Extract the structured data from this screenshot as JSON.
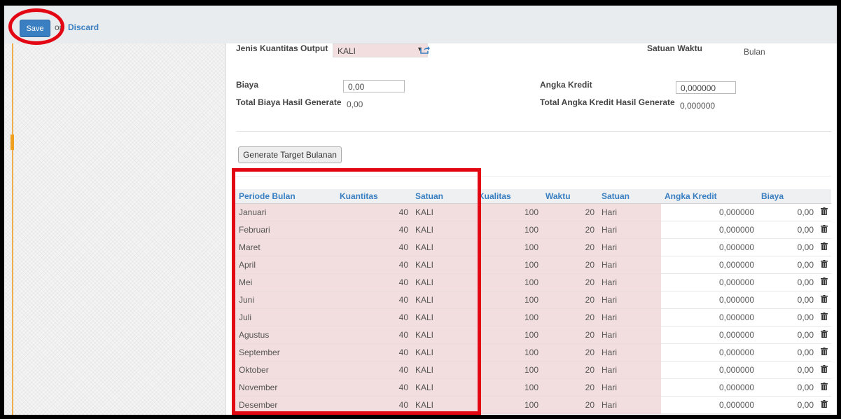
{
  "toolbar": {
    "save_label": "Save",
    "or_text": "or",
    "discard_label": "Discard"
  },
  "form": {
    "jenis_kuantitas_label": "Jenis Kuantitas Output",
    "jenis_kuantitas_value": "KALI",
    "satuan_waktu_label": "Satuan Waktu",
    "satuan_waktu_value": "Bulan",
    "biaya_label": "Biaya",
    "biaya_value": "0,00",
    "angka_kredit_label": "Angka Kredit",
    "angka_kredit_value": "0,000000",
    "total_biaya_label": "Total Biaya Hasil Generate",
    "total_biaya_value": "0,00",
    "total_angka_label": "Total Angka Kredit Hasil Generate",
    "total_angka_value": "0,000000",
    "generate_button_label": "Generate Target Bulanan"
  },
  "table": {
    "headers": [
      "Periode Bulan",
      "Kuantitas",
      "Satuan",
      "Kualitas",
      "Waktu",
      "Satuan",
      "Angka Kredit",
      "Biaya"
    ],
    "rows": [
      [
        "Januari",
        "40",
        "KALI",
        "100",
        "20",
        "Hari",
        "0,000000",
        "0,00"
      ],
      [
        "Februari",
        "40",
        "KALI",
        "100",
        "20",
        "Hari",
        "0,000000",
        "0,00"
      ],
      [
        "Maret",
        "40",
        "KALI",
        "100",
        "20",
        "Hari",
        "0,000000",
        "0,00"
      ],
      [
        "April",
        "40",
        "KALI",
        "100",
        "20",
        "Hari",
        "0,000000",
        "0,00"
      ],
      [
        "Mei",
        "40",
        "KALI",
        "100",
        "20",
        "Hari",
        "0,000000",
        "0,00"
      ],
      [
        "Juni",
        "40",
        "KALI",
        "100",
        "20",
        "Hari",
        "0,000000",
        "0,00"
      ],
      [
        "Juli",
        "40",
        "KALI",
        "100",
        "20",
        "Hari",
        "0,000000",
        "0,00"
      ],
      [
        "Agustus",
        "40",
        "KALI",
        "100",
        "20",
        "Hari",
        "0,000000",
        "0,00"
      ],
      [
        "September",
        "40",
        "KALI",
        "100",
        "20",
        "Hari",
        "0,000000",
        "0,00"
      ],
      [
        "Oktober",
        "40",
        "KALI",
        "100",
        "20",
        "Hari",
        "0,000000",
        "0,00"
      ],
      [
        "November",
        "40",
        "KALI",
        "100",
        "20",
        "Hari",
        "0,000000",
        "0,00"
      ],
      [
        "Desember",
        "40",
        "KALI",
        "100",
        "20",
        "Hari",
        "0,000000",
        "0,00"
      ]
    ]
  },
  "icons": {
    "external": "external-link-icon",
    "delete": "trash-icon",
    "dropdown": "caret-down-icon"
  },
  "colors": {
    "accent": "#3a7fc1",
    "highlight": "#e30613",
    "readonly_fill": "#f2dede"
  }
}
